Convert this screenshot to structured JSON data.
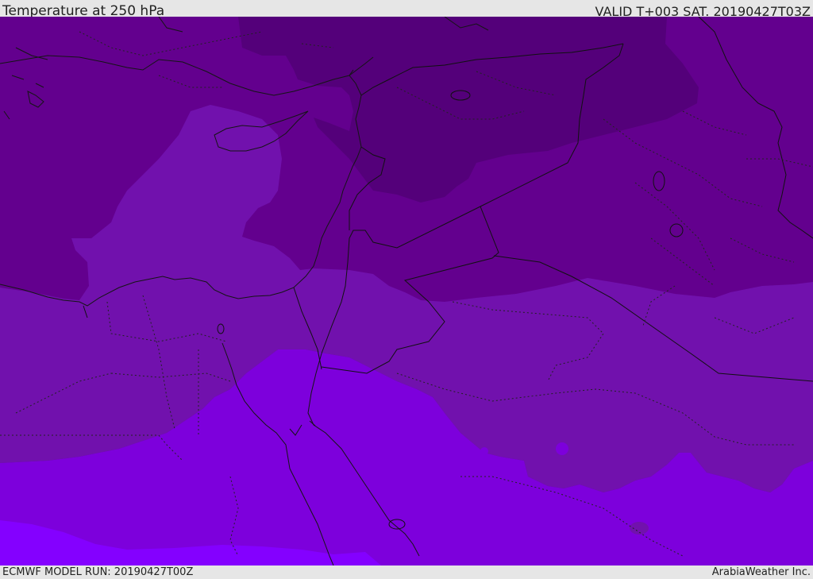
{
  "header": {
    "title": "Temperature at 250 hPa",
    "valid": "VALID T+003 SAT. 20190427T03Z"
  },
  "footer": {
    "model_run": "ECMWF MODEL RUN: 20190427T00Z",
    "credit": "ArabiaWeather Inc."
  },
  "map": {
    "colors": {
      "band_darkest": "#54007a",
      "band_dark": "#63008e",
      "band_mid": "#7111ad",
      "band_bright": "#7d00dc",
      "band_brightest": "#8400ff",
      "line_color": "#111111"
    }
  }
}
